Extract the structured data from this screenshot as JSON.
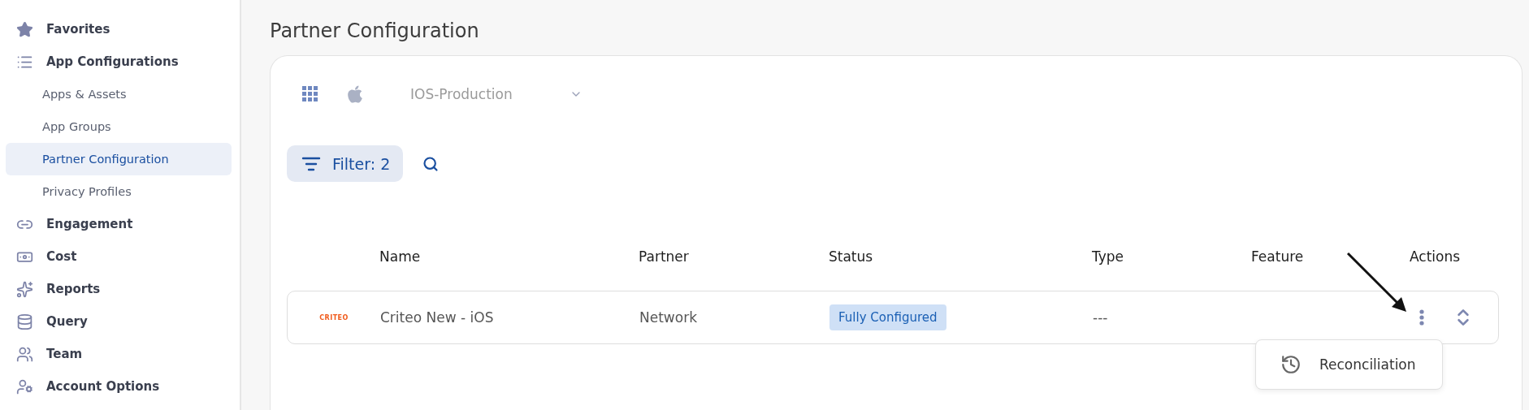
{
  "sidebar": {
    "items": [
      {
        "kind": "section",
        "label": "Favorites",
        "selected": false
      },
      {
        "kind": "section",
        "label": "App Configurations",
        "selected": false
      },
      {
        "kind": "sub",
        "label": "Apps & Assets",
        "selected": false
      },
      {
        "kind": "sub",
        "label": "App Groups",
        "selected": false
      },
      {
        "kind": "sub",
        "label": "Partner Configuration",
        "selected": true
      },
      {
        "kind": "sub",
        "label": "Privacy Profiles",
        "selected": false
      },
      {
        "kind": "section",
        "label": "Engagement",
        "selected": false
      },
      {
        "kind": "section",
        "label": "Cost",
        "selected": false
      },
      {
        "kind": "section",
        "label": "Reports",
        "selected": false
      },
      {
        "kind": "section",
        "label": "Query",
        "selected": false
      },
      {
        "kind": "section",
        "label": "Team",
        "selected": false
      },
      {
        "kind": "section",
        "label": "Account Options",
        "selected": false
      }
    ]
  },
  "page": {
    "title": "Partner Configuration"
  },
  "app_selector": {
    "value": "IOS-Production"
  },
  "filter": {
    "label": "Filter:",
    "count": "2"
  },
  "table": {
    "columns": [
      "Name",
      "Partner",
      "Status",
      "Type",
      "Feature",
      "Actions"
    ],
    "rows": [
      {
        "logo_text": "CRITEO",
        "name": "Criteo New - iOS",
        "partner": "Network",
        "status": "Fully Configured",
        "type": "---"
      }
    ]
  },
  "actions_menu": {
    "items": [
      "Reconciliation"
    ]
  }
}
